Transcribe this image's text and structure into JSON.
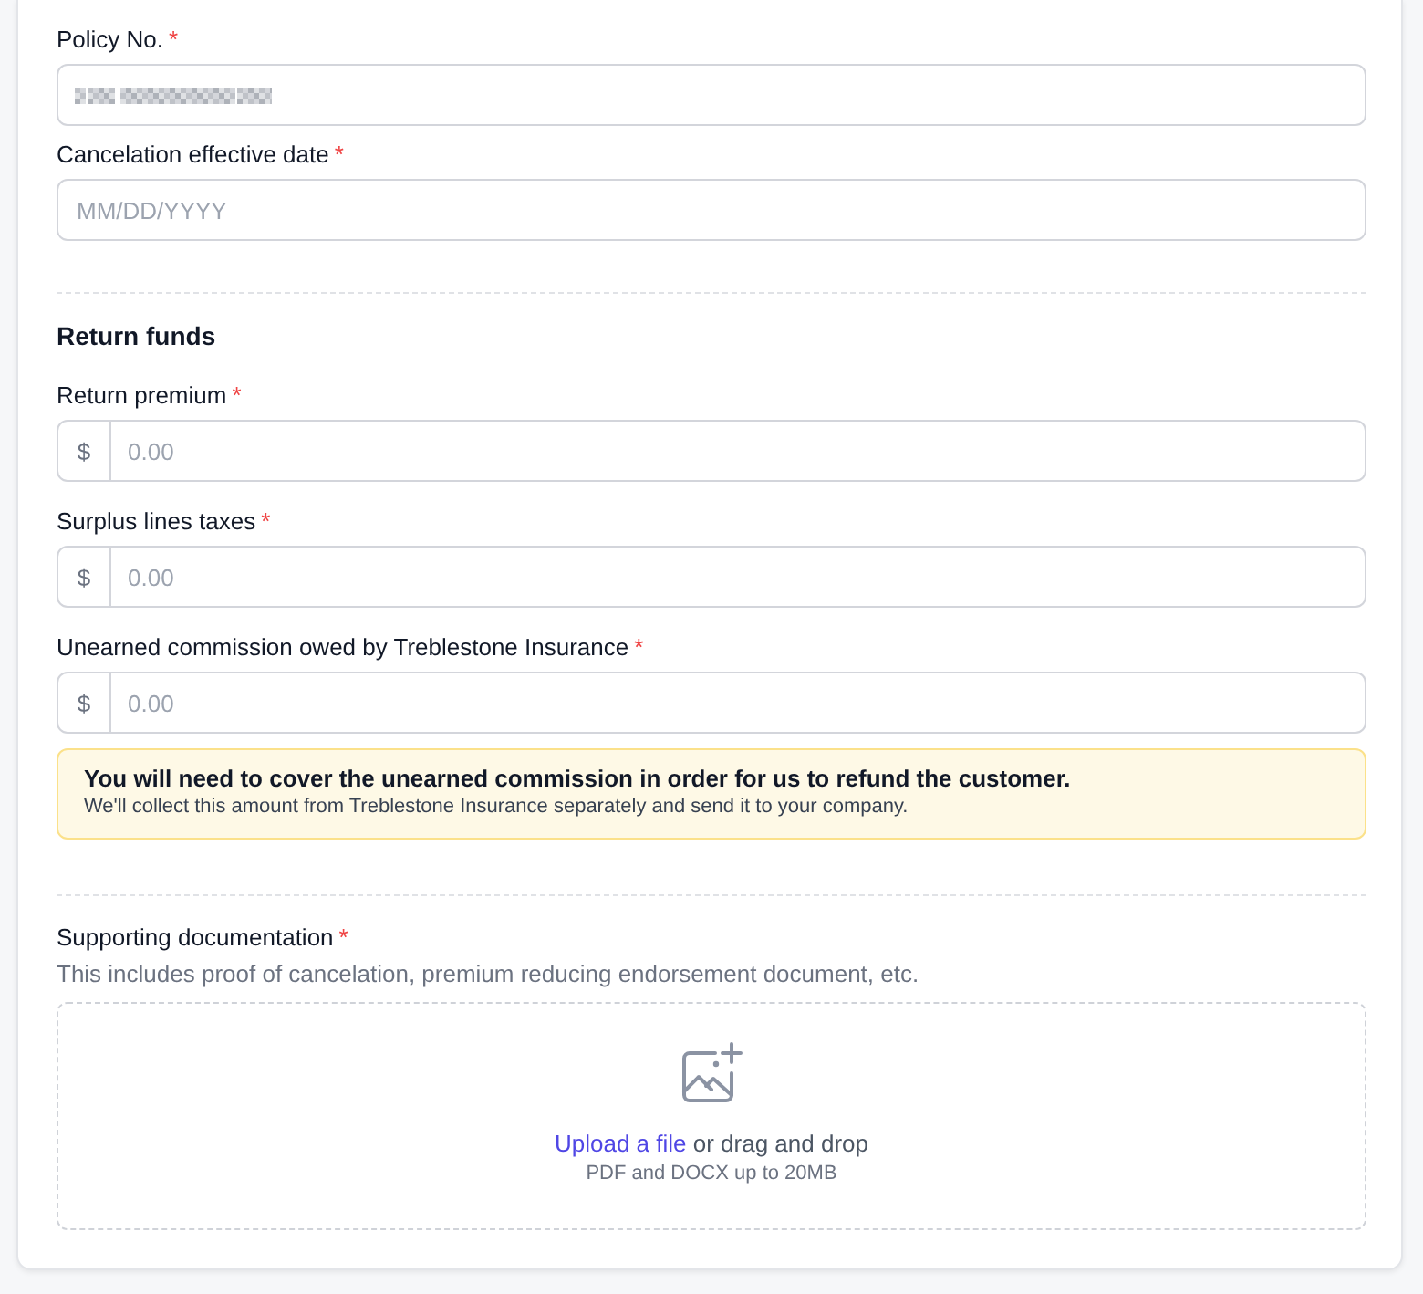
{
  "policy": {
    "fields": [
      {
        "kind": "text",
        "label": "Policy No.",
        "required_mark": "*",
        "value_redacted": true
      },
      {
        "kind": "text",
        "label": "Cancelation effective date",
        "required_mark": "*",
        "placeholder": "MM/DD/YYYY"
      }
    ]
  },
  "return_funds": {
    "title": "Return funds",
    "fields": [
      {
        "kind": "currency",
        "label": "Return premium",
        "required_mark": "*",
        "prefix": "$",
        "placeholder": "0.00"
      },
      {
        "kind": "currency",
        "label": "Surplus lines taxes",
        "required_mark": "*",
        "prefix": "$",
        "placeholder": "0.00"
      },
      {
        "kind": "currency",
        "label": "Unearned commission owed by Treblestone Insurance",
        "required_mark": "*",
        "prefix": "$",
        "placeholder": "0.00"
      }
    ],
    "alert": {
      "title": "You will need to cover the unearned commission in order for us to refund the customer.",
      "body": "We'll collect this amount from Treblestone Insurance separately and send it to your company."
    }
  },
  "supporting_documentation": {
    "label": "Supporting documentation",
    "required_mark": "*",
    "description": "This includes proof of cancelation, premium reducing endorsement document, etc.",
    "dropzone": {
      "link": "Upload a file",
      "text": "or drag and drop",
      "hint": "PDF and DOCX up to 20MB"
    }
  }
}
